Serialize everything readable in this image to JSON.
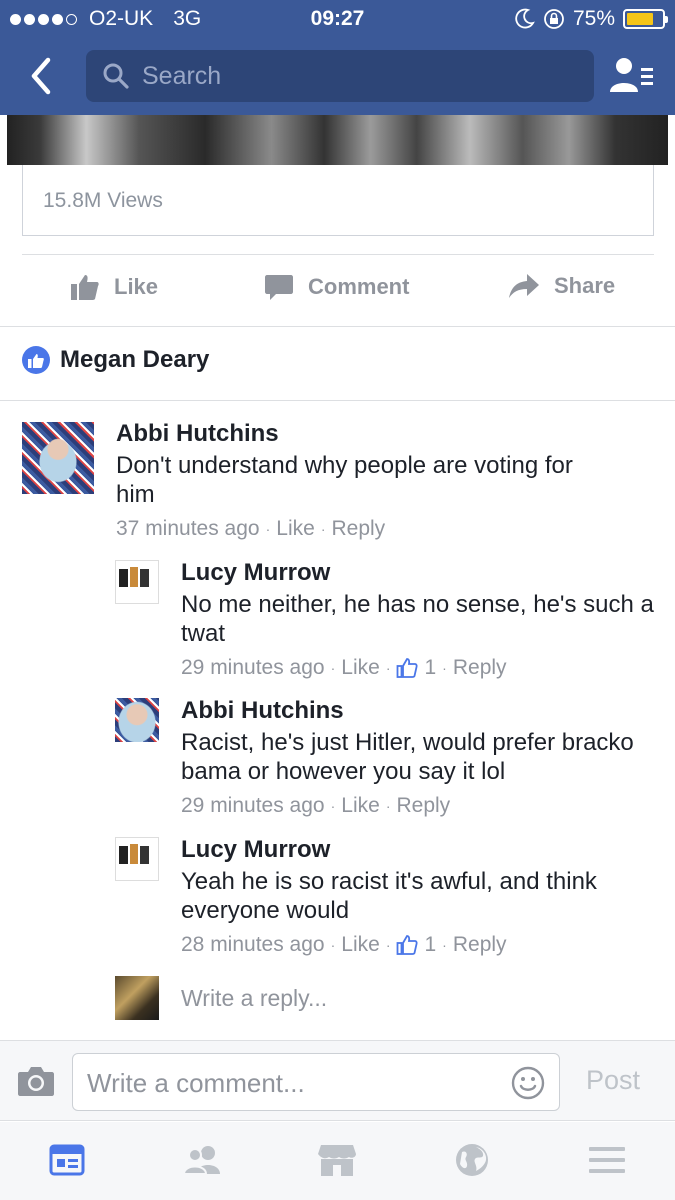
{
  "status_bar": {
    "carrier": "O2-UK",
    "network": "3G",
    "time": "09:27",
    "battery": "75%",
    "battery_level": 0.75
  },
  "search": {
    "placeholder": "Search"
  },
  "video": {
    "views": "15.8M Views"
  },
  "actions": {
    "like": "Like",
    "comment": "Comment",
    "share": "Share"
  },
  "likers": {
    "name": "Megan Deary"
  },
  "comments": [
    {
      "author": "Abbi Hutchins",
      "text": "Don't understand why people are voting for him",
      "time": "37 minutes ago",
      "like": "Like",
      "reply": "Reply"
    }
  ],
  "replies": [
    {
      "author": "Lucy Murrow",
      "text": "No me neither, he has no sense, he's such a twat",
      "time": "29 minutes ago",
      "like": "Like",
      "like_count": "1",
      "reply": "Reply"
    },
    {
      "author": "Abbi Hutchins",
      "text": "Racist, he's just Hitler,  would prefer bracko bama or however you say it lol",
      "time": "29 minutes ago",
      "like": "Like",
      "reply": "Reply"
    },
    {
      "author": "Lucy Murrow",
      "text": "Yeah he is so racist it's awful, and think everyone would",
      "time": "28 minutes ago",
      "like": "Like",
      "like_count": "1",
      "reply": "Reply"
    }
  ],
  "reply_box": {
    "placeholder": "Write a reply..."
  },
  "composer": {
    "placeholder": "Write a comment...",
    "post": "Post"
  },
  "colors": {
    "brand": "#3b5998",
    "meta": "#90949c",
    "like_blue": "#4a76e8",
    "battery": "#f5c518"
  },
  "tabbar": [
    "news-feed-icon",
    "friends-icon",
    "marketplace-icon",
    "globe-icon",
    "menu-icon"
  ]
}
